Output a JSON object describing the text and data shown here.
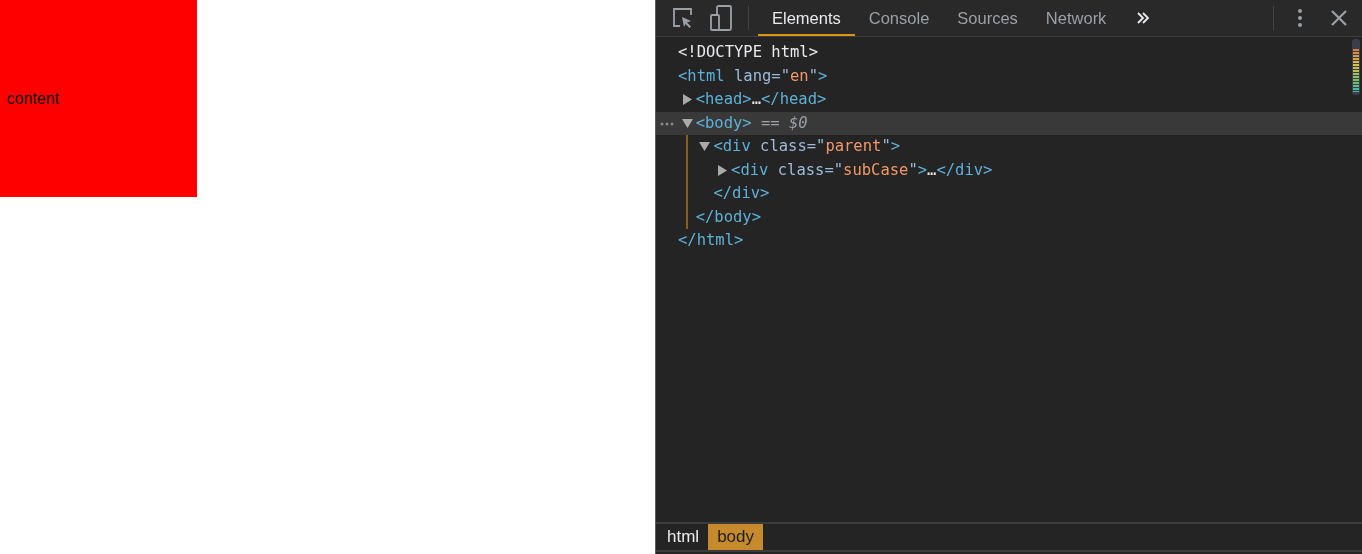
{
  "page": {
    "box_text": "content"
  },
  "devtools": {
    "tabs": [
      {
        "label": "Elements",
        "selected": true
      },
      {
        "label": "Console",
        "selected": false
      },
      {
        "label": "Sources",
        "selected": false
      },
      {
        "label": "Network",
        "selected": false
      }
    ],
    "tree": [
      {
        "selected": false,
        "parts": [
          {
            "kind": "plain",
            "text": "<!DOCTYPE html>"
          }
        ]
      },
      {
        "selected": false,
        "parts": [
          {
            "kind": "tag",
            "text": "<html"
          },
          {
            "kind": "attr",
            "text": " lang=\""
          },
          {
            "kind": "value",
            "text": "en"
          },
          {
            "kind": "attr",
            "text": "\""
          },
          {
            "kind": "tag",
            "text": ">"
          }
        ],
        "children": [
          {
            "selected": false,
            "expanded": false,
            "parts": [
              {
                "kind": "tag",
                "text": "<head>"
              },
              {
                "kind": "plain",
                "text": "…"
              },
              {
                "kind": "tag",
                "text": "</head>"
              }
            ]
          },
          {
            "selected": true,
            "expanded": true,
            "parts": [
              {
                "kind": "tag",
                "text": "<body>"
              },
              {
                "kind": "dim",
                "text": " == $0"
              }
            ],
            "children": [
              {
                "selected": false,
                "expanded": true,
                "parts": [
                  {
                    "kind": "tag",
                    "text": "<div"
                  },
                  {
                    "kind": "attr",
                    "text": " class=\""
                  },
                  {
                    "kind": "value",
                    "text": "parent"
                  },
                  {
                    "kind": "attr",
                    "text": "\""
                  },
                  {
                    "kind": "tag",
                    "text": ">"
                  }
                ],
                "children": [
                  {
                    "selected": false,
                    "expanded": false,
                    "parts": [
                      {
                        "kind": "tag",
                        "text": "<div"
                      },
                      {
                        "kind": "attr",
                        "text": " class=\""
                      },
                      {
                        "kind": "value",
                        "text": "subCase"
                      },
                      {
                        "kind": "attr",
                        "text": "\""
                      },
                      {
                        "kind": "tag",
                        "text": ">"
                      },
                      {
                        "kind": "plain",
                        "text": "…"
                      },
                      {
                        "kind": "tag",
                        "text": "</div>"
                      }
                    ]
                  }
                ],
                "closing": [
                  {
                    "kind": "tag",
                    "text": "</div>"
                  }
                ]
              }
            ],
            "closing": [
              {
                "kind": "tag",
                "text": "</body>"
              }
            ]
          }
        ],
        "closing": [
          {
            "kind": "tag",
            "text": "</html>"
          }
        ]
      }
    ],
    "breadcrumbs": [
      {
        "label": "html",
        "selected": false
      },
      {
        "label": "body",
        "selected": true
      }
    ]
  }
}
